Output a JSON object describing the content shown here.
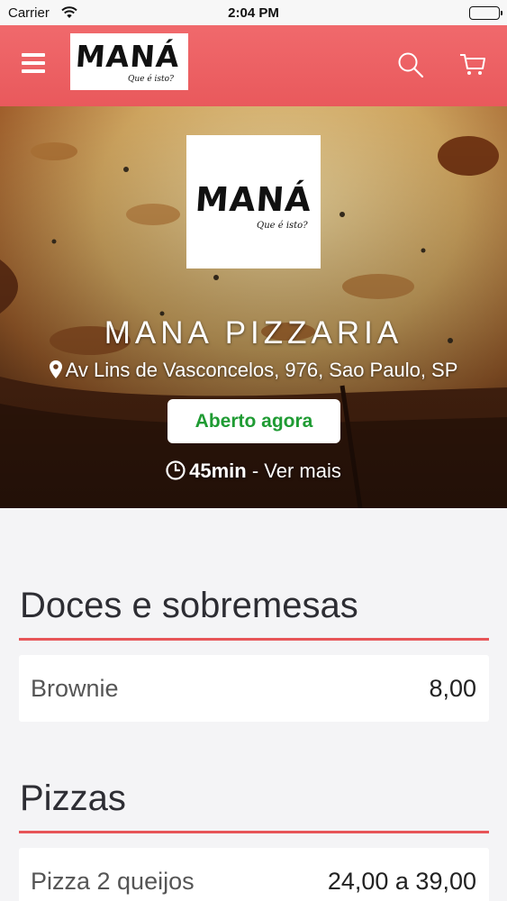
{
  "status_bar": {
    "carrier": "Carrier",
    "time": "2:04 PM"
  },
  "navbar": {
    "logo_text": "MANÁ",
    "logo_tagline": "Que é isto?",
    "icons": [
      "menu-icon",
      "search-icon",
      "cart-icon"
    ],
    "color": "#ec6164"
  },
  "store": {
    "logo_text": "MANÁ",
    "logo_tagline": "Que é isto?",
    "name": "MANA PIZZARIA",
    "address": "Av Lins de Vasconcelos, 976, Sao Paulo, SP",
    "status": "Aberto agora",
    "delivery_time": "45min",
    "see_more": " - Ver mais"
  },
  "sections": [
    {
      "title": "Doces e sobremesas",
      "items": [
        {
          "name": "Brownie",
          "price": "8,00"
        }
      ]
    },
    {
      "title": "Pizzas",
      "items": [
        {
          "name": "Pizza 2 queijos",
          "price": "24,00 a 39,00"
        }
      ]
    }
  ],
  "colors": {
    "accent": "#e75558",
    "open_status": "#1f9b33"
  }
}
